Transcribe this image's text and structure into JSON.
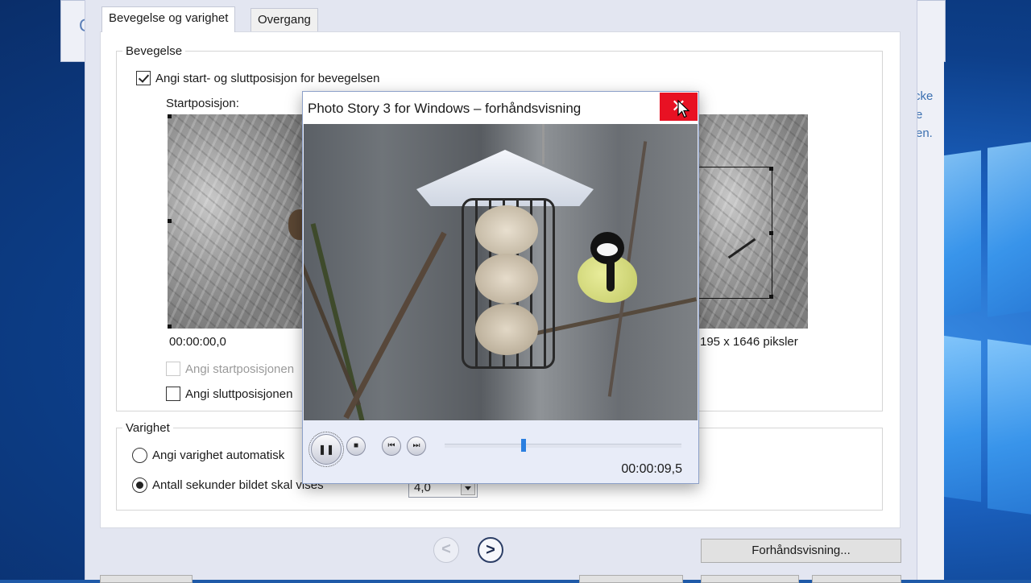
{
  "background_window": {
    "partial_text_left": "C",
    "partial_text_right": [
      "cke",
      "e",
      "en."
    ]
  },
  "tabs": [
    {
      "label": "Bevegelse og varighet",
      "active": true
    },
    {
      "label": "Overgang",
      "active": false
    }
  ],
  "motion_group": {
    "legend": "Bevegelse",
    "enable_checkbox": {
      "label": "Angi start- og sluttposisjon for bevegelsen",
      "checked": true
    },
    "start_label": "Startposisjon:",
    "start_time": "00:00:00,0",
    "end_size_text": "195 x 1646 piksler",
    "set_start_checkbox": {
      "label": "Angi startposisjonen",
      "checked": false,
      "enabled": false
    },
    "set_end_checkbox": {
      "label": "Angi sluttposisjonen",
      "checked": false,
      "enabled": true
    }
  },
  "duration_group": {
    "legend": "Varighet",
    "auto_radio": {
      "label": "Angi varighet automatisk",
      "selected": false
    },
    "seconds_radio": {
      "label": "Antall sekunder bildet skal vises",
      "selected": true
    },
    "seconds_value": "4,0"
  },
  "footer": {
    "back_label": "<",
    "next_label": ">",
    "preview_button": "Forhåndsvisning..."
  },
  "preview_window": {
    "title": "Photo Story 3 for Windows – forhåndsvisning",
    "close_label": "✕",
    "time": "00:00:09,5",
    "progress": 0.33,
    "controls": [
      "pause",
      "stop",
      "previous",
      "next"
    ]
  },
  "colors": {
    "accent": "#2a7fe0",
    "close_red": "#e81123",
    "dialog_bg": "#e3e6f1"
  }
}
